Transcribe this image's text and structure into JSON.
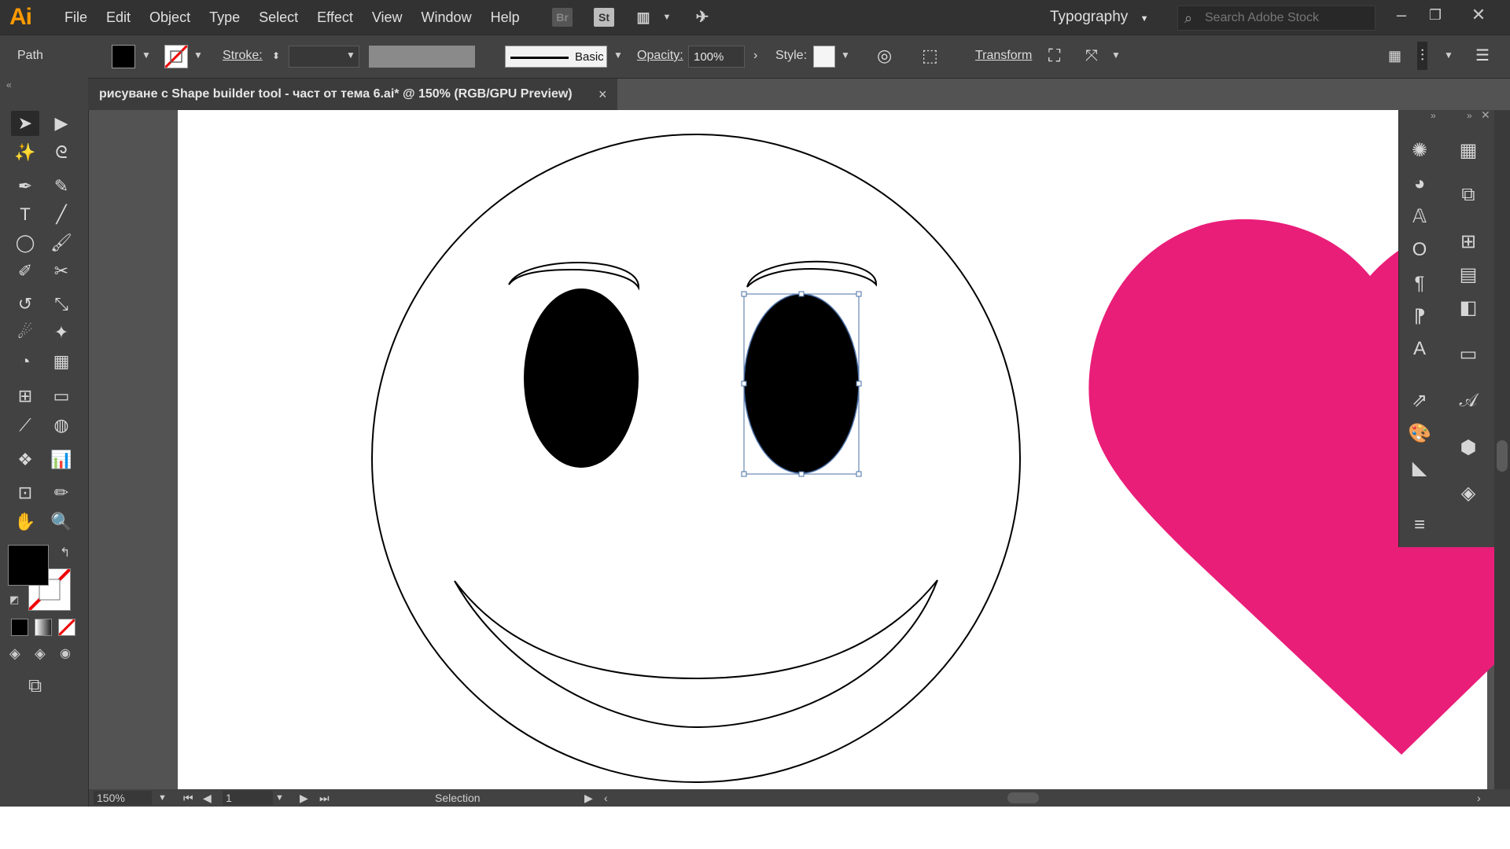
{
  "app": {
    "logo": "Ai"
  },
  "menu": [
    "File",
    "Edit",
    "Object",
    "Type",
    "Select",
    "Effect",
    "View",
    "Window",
    "Help"
  ],
  "topbar": {
    "bridge": "Br",
    "stock": "St",
    "workspace": "Typography",
    "search_placeholder": "Search Adobe Stock"
  },
  "controlbar": {
    "selection_type": "Path",
    "stroke_label": "Stroke:",
    "brush_label": "Basic",
    "opacity_label": "Opacity:",
    "opacity_value": "100%",
    "style_label": "Style:",
    "transform_label": "Transform"
  },
  "document": {
    "tab_title": "рисуване с Shape builder tool - част от тема 6.ai* @ 150% (RGB/GPU Preview)",
    "close_glyph": "×"
  },
  "status": {
    "zoom": "150%",
    "page": "1",
    "tool": "Selection"
  },
  "colors": {
    "heart": "#e91e79",
    "selection": "#4a6fa5",
    "fill": "#000000"
  },
  "icons": {
    "tools": [
      "selection-tool-icon",
      "direct-selection-tool-icon",
      "magic-wand-icon",
      "lasso-icon",
      "pen-tool-icon",
      "curvature-tool-icon",
      "type-tool-icon",
      "line-tool-icon",
      "ellipse-tool-icon",
      "paintbrush-icon",
      "shaper-tool-icon",
      "scissors-icon",
      "rotate-tool-icon",
      "scale-tool-icon",
      "warp-tool-icon",
      "puppet-warp-icon",
      "shape-builder-icon",
      "perspective-grid-icon",
      "mesh-tool-icon",
      "gradient-tool-icon",
      "eyedropper-icon",
      "blend-tool-icon",
      "symbol-sprayer-icon",
      "graph-tool-icon",
      "artboard-tool-icon",
      "slice-tool-icon",
      "hand-tool-icon",
      "zoom-tool-icon"
    ],
    "right_panel": [
      "color-icon",
      "swatches-icon",
      "libraries-icon",
      "transform-icon",
      "character-icon",
      "align-icon",
      "glyphs-icon",
      "pathfinder-icon",
      "paragraph-icon",
      "gradient-panel-icon",
      "opentype-icon",
      "character-styles-icon",
      "export-icon",
      "graphic-styles-icon",
      "appearance-icon",
      "symbols-icon",
      "stroke-panel-icon",
      "layers-icon",
      "menu-icon"
    ]
  }
}
